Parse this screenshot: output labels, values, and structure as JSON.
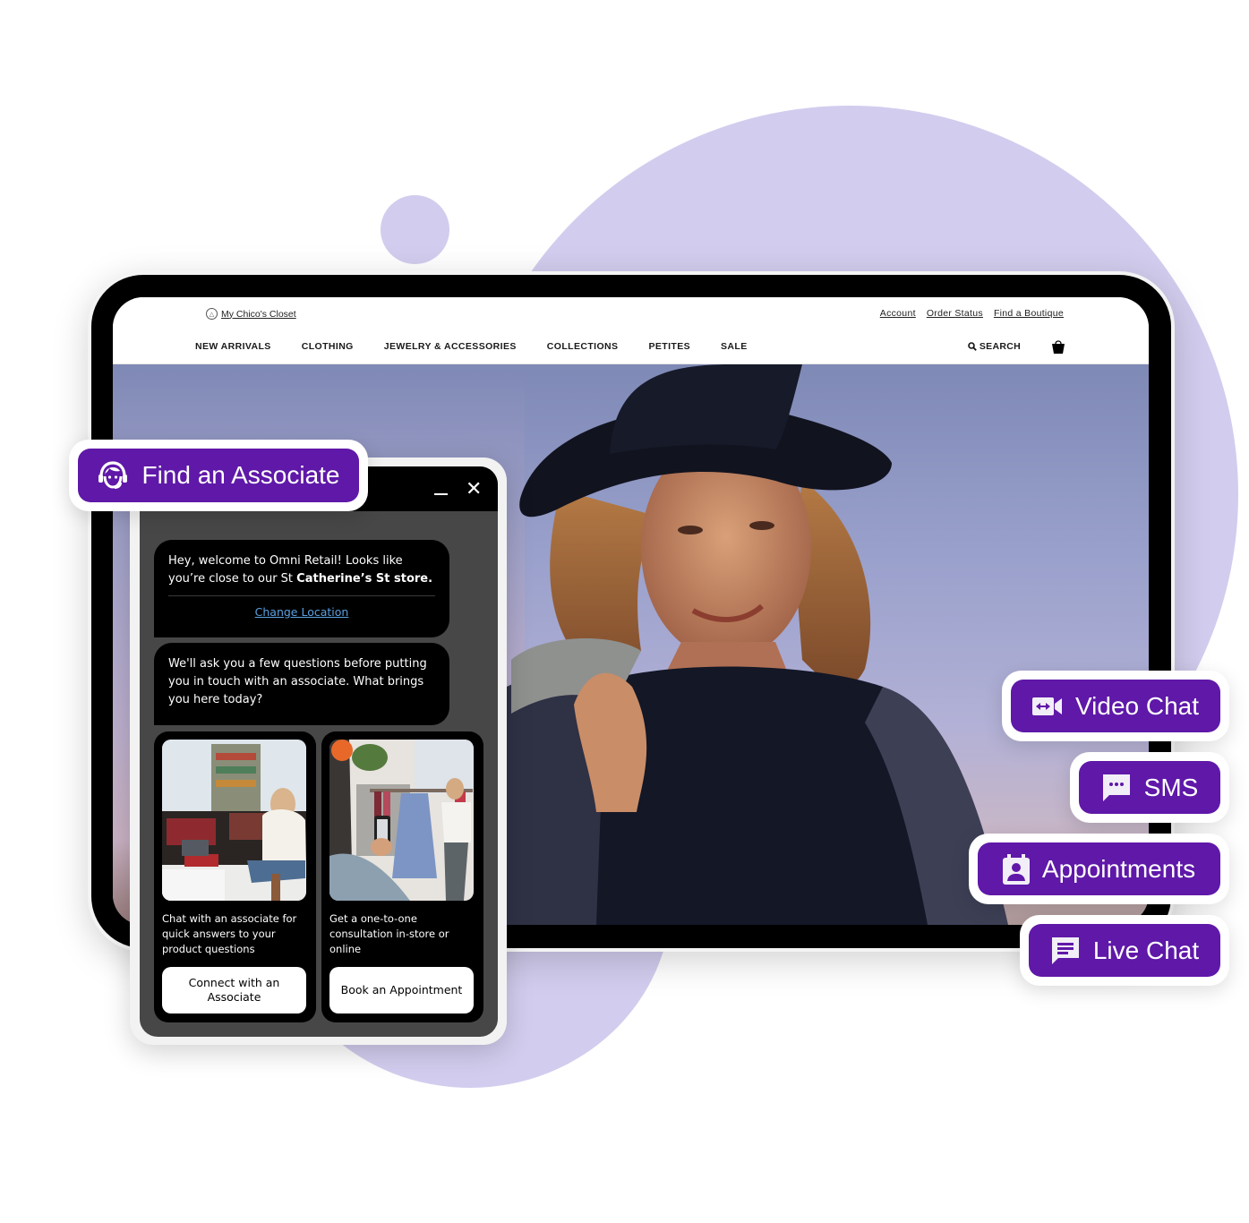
{
  "site": {
    "closet_link": "My Chico's Closet",
    "utility_links": [
      "Account",
      "Order Status",
      "Find a Boutique"
    ],
    "nav_items": [
      "NEW ARRIVALS",
      "CLOTHING",
      "JEWELRY & ACCESSORIES",
      "COLLECTIONS",
      "PETITES",
      "SALE"
    ],
    "search_label": "SEARCH",
    "icons": {
      "closet": "hanger-icon",
      "search": "search-icon",
      "bag": "shopping-bag-icon"
    }
  },
  "find_associate": {
    "label": "Find an Associate",
    "icon": "headset-agent-icon"
  },
  "chat": {
    "minimize_icon": "minimize-icon",
    "close_icon": "close-icon",
    "close_glyph": "✕",
    "welcome": {
      "text_prefix": "Hey, welcome to Omni Retail! Looks like you’re close to our St ",
      "text_bold": "Catherine’s St store.",
      "change_location": "Change Location"
    },
    "question": "We'll ask you a few questions before putting you in touch with an associate. What brings you here today?",
    "options": [
      {
        "image": "woman-on-laptop-photo",
        "description": "Chat with an associate for quick answers to your product questions",
        "button": "Connect with an Associate"
      },
      {
        "image": "boutique-consultation-photo",
        "description": "Get a one-to-one consultation in-store or online",
        "button": "Book an Appointment"
      }
    ]
  },
  "channels": [
    {
      "label": "Video Chat",
      "icon": "video-camera-icon"
    },
    {
      "label": "SMS",
      "icon": "sms-icon"
    },
    {
      "label": "Appointments",
      "icon": "calendar-person-icon"
    },
    {
      "label": "Live Chat",
      "icon": "chat-bubble-icon"
    }
  ],
  "colors": {
    "accent": "#5f18a8",
    "blob": "#d2cdee",
    "link": "#5aa0e0",
    "chat_bg": "#474747"
  }
}
